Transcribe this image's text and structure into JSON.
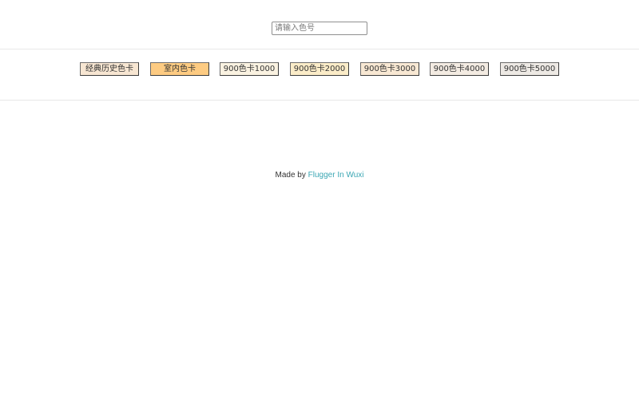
{
  "search": {
    "placeholder": "请输入色号",
    "value": ""
  },
  "tabs": [
    {
      "label": "经典历史色卡",
      "color": "#f7e6d2"
    },
    {
      "label": "室内色卡",
      "color": "#fdcb82"
    },
    {
      "label": "900色卡1000",
      "color": "#faf2e1"
    },
    {
      "label": "900色卡2000",
      "color": "#fbecc8"
    },
    {
      "label": "900色卡3000",
      "color": "#f8e8d3"
    },
    {
      "label": "900色卡4000",
      "color": "#f3ebe2"
    },
    {
      "label": "900色卡5000",
      "color": "#ede9e4"
    }
  ],
  "footer": {
    "prefix": "Made by ",
    "link_text": "Flugger In Wuxi",
    "link_color": "#3aa6b3"
  }
}
